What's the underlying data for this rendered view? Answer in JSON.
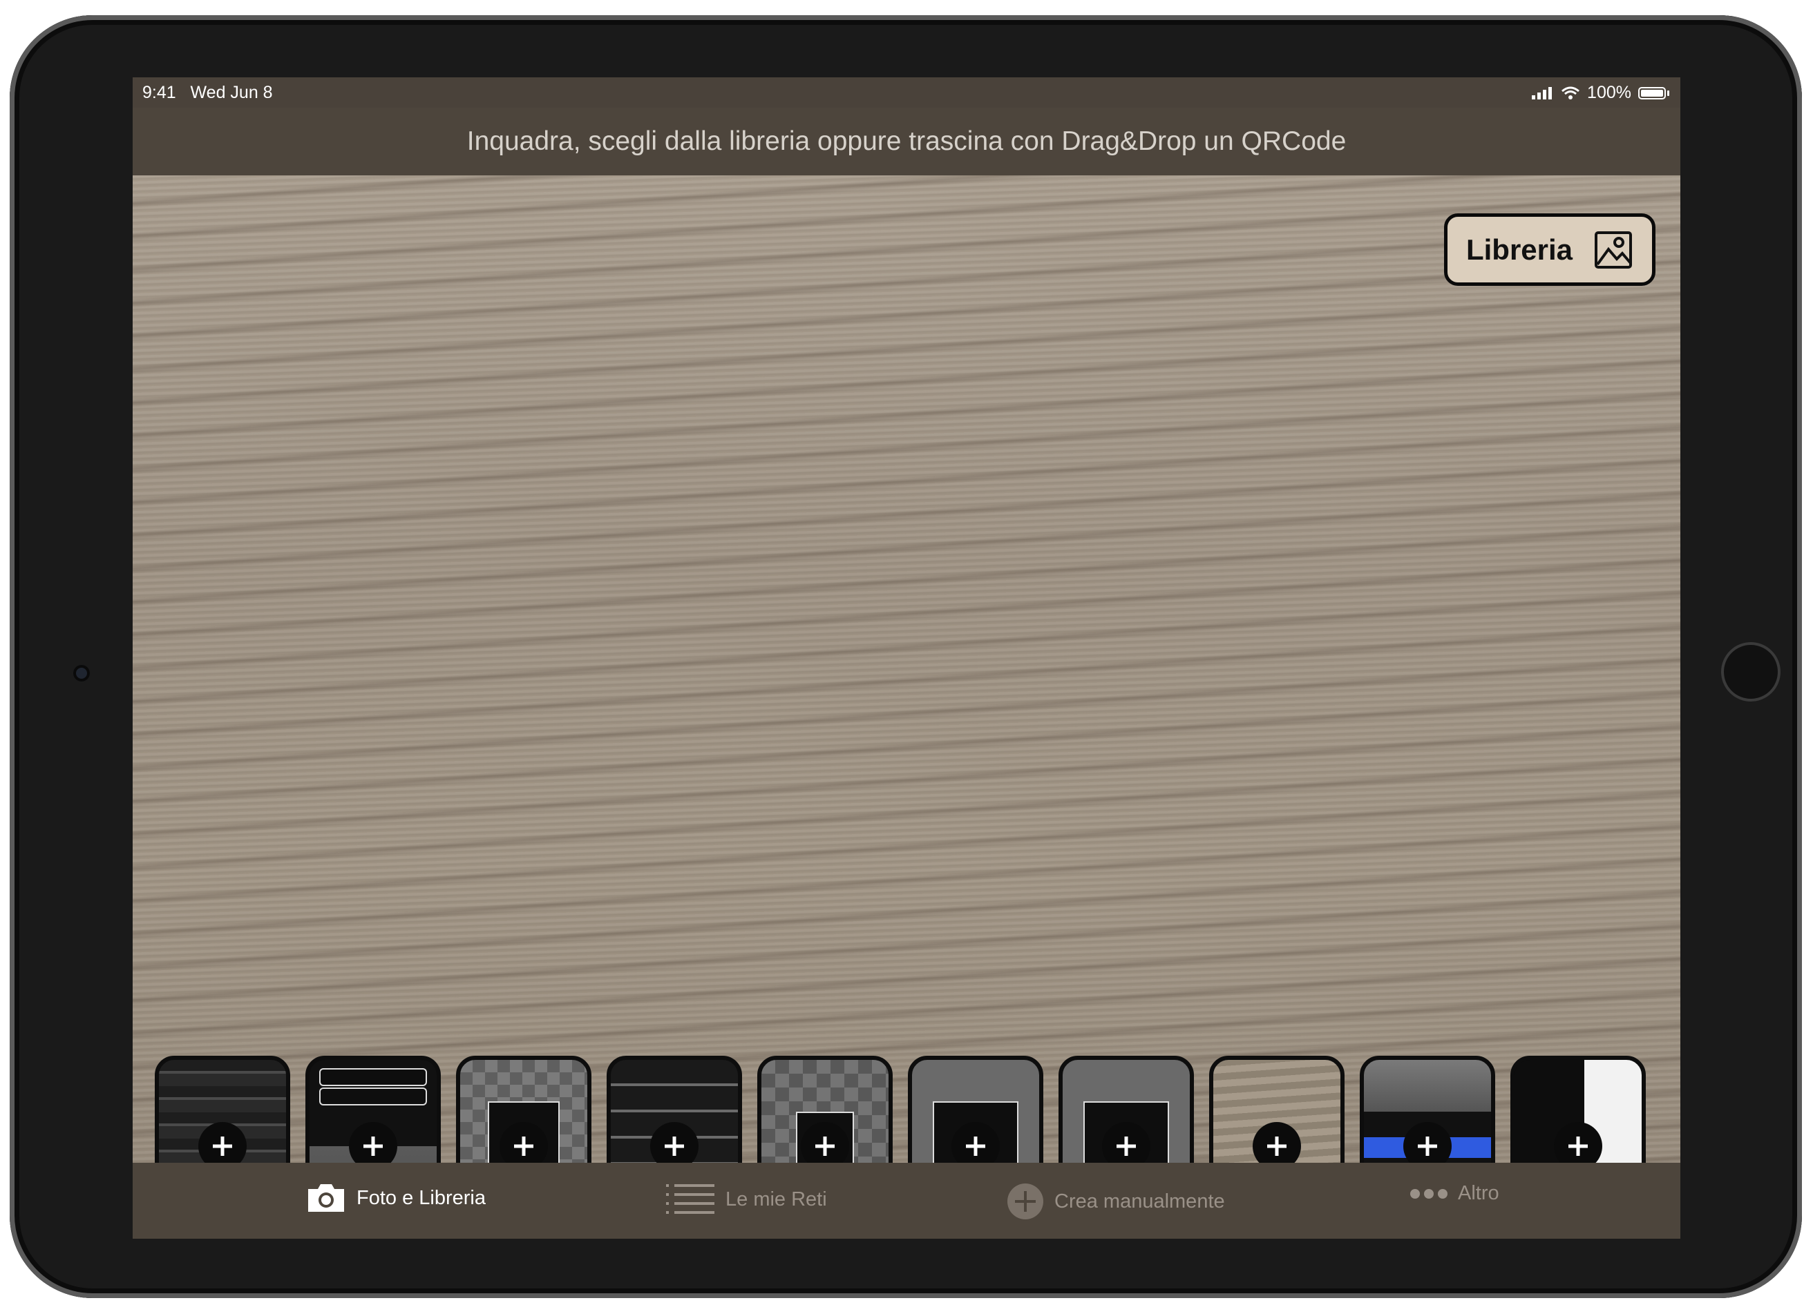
{
  "status_bar": {
    "time": "9:41",
    "date": "Wed Jun 8",
    "battery": "100%"
  },
  "header": {
    "title": "Inquadra, scegli dalla libreria oppure trascina con Drag&Drop un QRCode"
  },
  "library_button": {
    "label": "Libreria"
  },
  "thumbnails": [
    {
      "name": "screenshot-1"
    },
    {
      "name": "screenshot-2"
    },
    {
      "name": "screenshot-3"
    },
    {
      "name": "screenshot-4"
    },
    {
      "name": "screenshot-5"
    },
    {
      "name": "screenshot-6"
    },
    {
      "name": "screenshot-7"
    },
    {
      "name": "screenshot-8"
    },
    {
      "name": "screenshot-9"
    },
    {
      "name": "screenshot-10"
    }
  ],
  "tabs": [
    {
      "label": "Foto e Libreria",
      "icon": "camera-icon",
      "active": true
    },
    {
      "label": "Le mie Reti",
      "icon": "list-icon",
      "active": false
    },
    {
      "label": "Crea manualmente",
      "icon": "plus-circle-icon",
      "active": false
    },
    {
      "label": "Altro",
      "icon": "more-icon",
      "active": false
    }
  ],
  "colors": {
    "bar_background": "#4d453c",
    "active_tab": "#ffffff",
    "inactive_tab": "#9a9188",
    "library_button_bg": "#dccfbd"
  }
}
